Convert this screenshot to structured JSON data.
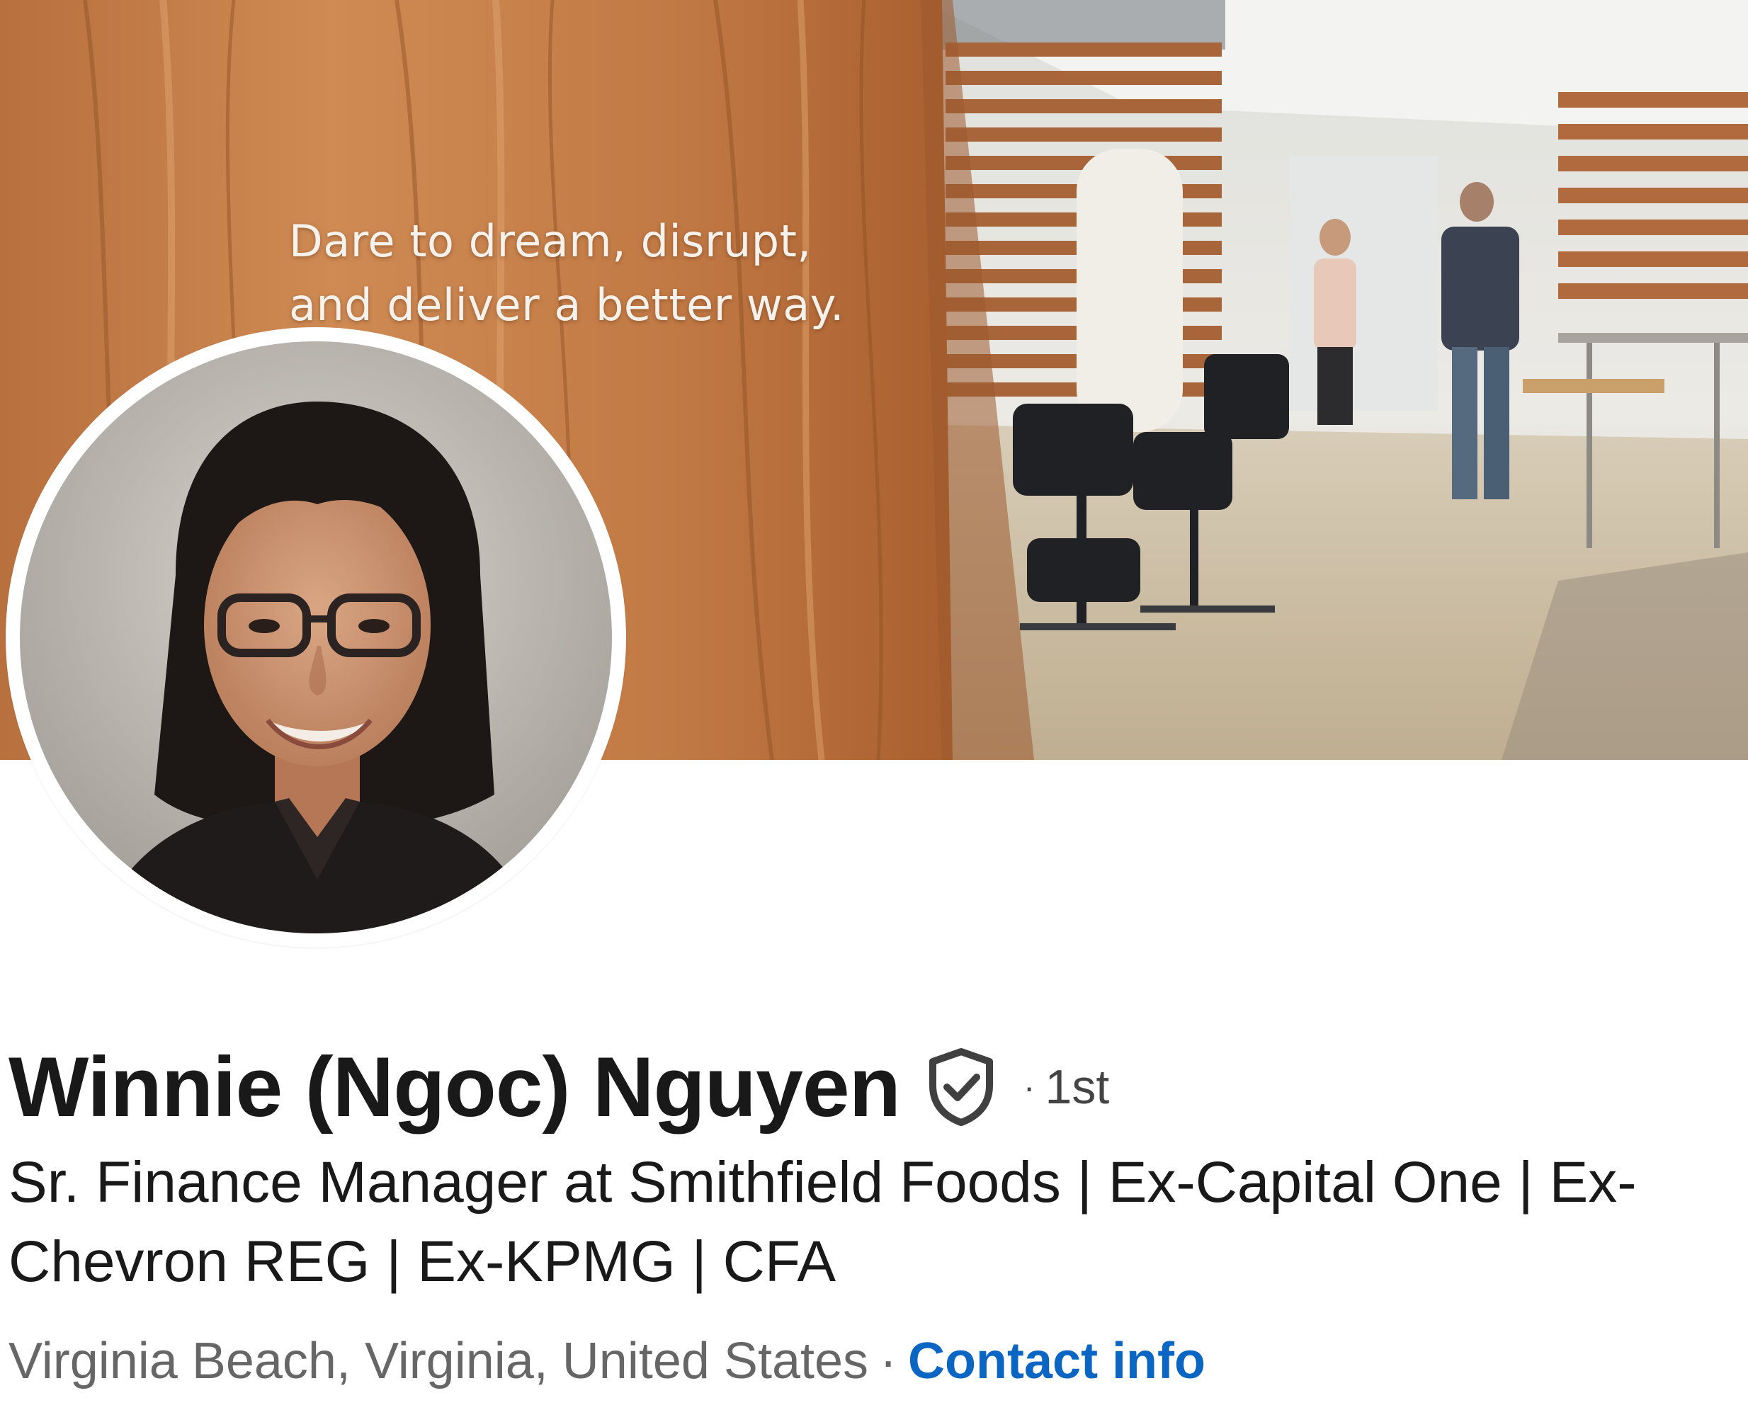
{
  "banner": {
    "tagline_line1": "Dare to dream, disrupt,",
    "tagline_line2": "and deliver a better way."
  },
  "profile": {
    "name": "Winnie (Ngoc) Nguyen",
    "verified_icon": "shield-check-icon",
    "degree_separator": "·",
    "connection_degree": "1st",
    "headline_line1": "Sr. Finance Manager at Smithfield Foods | Ex-Capital One | Ex-",
    "headline_line2": "Chevron REG | Ex-KPMG | CFA",
    "location": "Virginia Beach, Virginia, United States",
    "location_separator": "·",
    "contact_info_label": "Contact info"
  },
  "colors": {
    "name_text": "#191919",
    "secondary_text": "#666666",
    "link": "#0a66c2",
    "banner_wood": "#c27a45"
  }
}
